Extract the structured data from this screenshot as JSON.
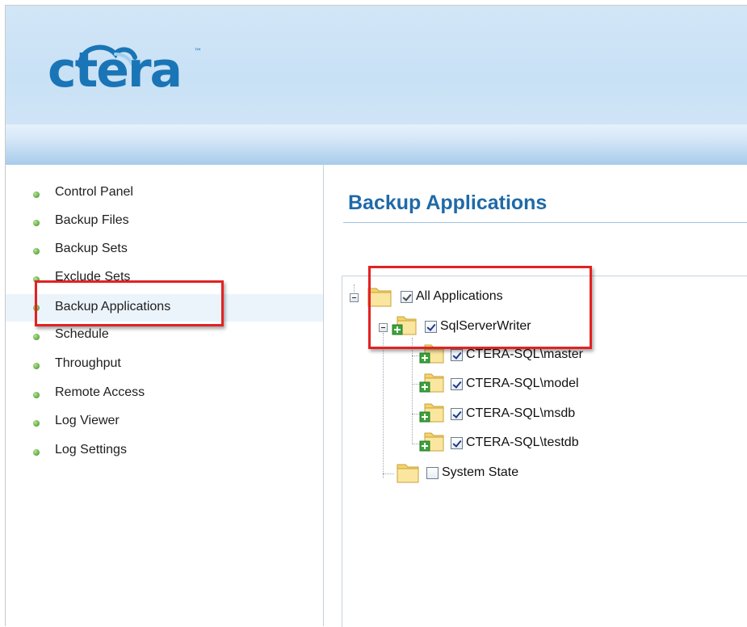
{
  "brand": {
    "logo_text": "ctera",
    "tm": "™",
    "color": "#1a75b6"
  },
  "sidebar": {
    "items": [
      {
        "label": "Control Panel"
      },
      {
        "label": "Backup Files"
      },
      {
        "label": "Backup Sets"
      },
      {
        "label": "Exclude Sets"
      },
      {
        "label": "Backup Applications",
        "active": true
      },
      {
        "label": "Schedule"
      },
      {
        "label": "Throughput"
      },
      {
        "label": "Remote Access"
      },
      {
        "label": "Log Viewer"
      },
      {
        "label": "Log Settings"
      }
    ]
  },
  "main": {
    "title": "Backup Applications",
    "title_color": "#1f6aa8",
    "tree": {
      "root": {
        "label": "All Applications",
        "checked": "partial"
      },
      "sql_writer": {
        "label": "SqlServerWriter",
        "checked": true
      },
      "databases": [
        {
          "label": "CTERA-SQL\\master",
          "checked": true
        },
        {
          "label": "CTERA-SQL\\model",
          "checked": true
        },
        {
          "label": "CTERA-SQL\\msdb",
          "checked": true
        },
        {
          "label": "CTERA-SQL\\testdb",
          "checked": true
        }
      ],
      "system_state": {
        "label": "System State",
        "checked": false
      }
    }
  },
  "colors": {
    "highlight": "#e22222",
    "dot": "#5ea83a"
  }
}
